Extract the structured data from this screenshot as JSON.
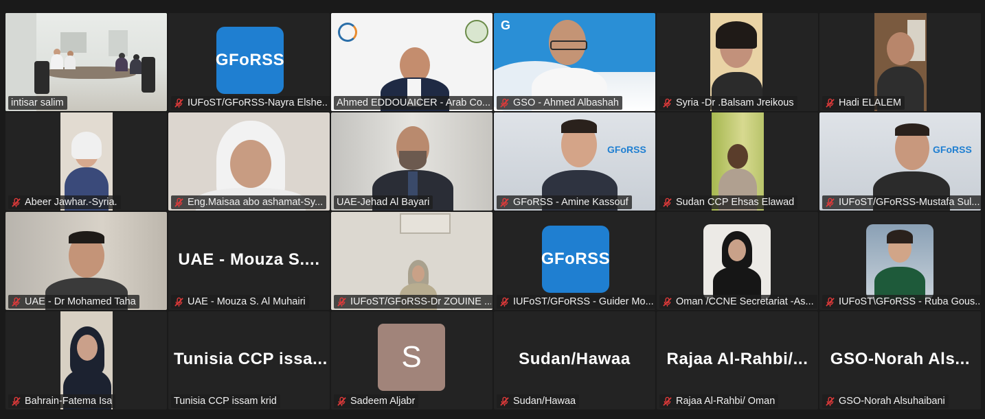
{
  "colors": {
    "active_border": "#23d962",
    "label_bg": "rgba(30,30,30,0.78)",
    "muted_icon": "#e03a3a",
    "avatar_bg": "#a1847a",
    "gforss_blue": "#1f7fd1"
  },
  "gforss_logo_text": "GFoRSS",
  "tiles": [
    {
      "label": "intisar salim",
      "muted": false,
      "active": true
    },
    {
      "label": "IUFoST/GFoRSS-Nayra Elshe...",
      "muted": true
    },
    {
      "label": "Ahmed EDDOUAICER - Arab Co...",
      "muted": false
    },
    {
      "label": "GSO - Ahmed Albashah",
      "muted": true
    },
    {
      "label": "Syria -Dr .Balsam Jreikous",
      "muted": true
    },
    {
      "label": "Hadi ELALEM",
      "muted": true
    },
    {
      "label": "Abeer Jawhar.-Syria.",
      "muted": true
    },
    {
      "label": "Eng.Maisaa abo ashamat-Sy...",
      "muted": true
    },
    {
      "label": "UAE-Jehad Al Bayari",
      "muted": false
    },
    {
      "label": "GFoRSS - Amine Kassouf",
      "muted": true
    },
    {
      "label": "Sudan CCP Ehsas Elawad",
      "muted": true
    },
    {
      "label": "IUFoST/GFoRSS-Mustafa Sul...",
      "muted": true
    },
    {
      "label": "UAE - Dr Mohamed Taha",
      "muted": true
    },
    {
      "label": "UAE - Mouza S. Al Muhairi",
      "muted": true,
      "display_name": "UAE - Mouza S...."
    },
    {
      "label": "IUFoST/GFoRSS-Dr ZOUINE ...",
      "muted": true
    },
    {
      "label": "IUFoST/GFoRSS - Guider Mo...",
      "muted": true
    },
    {
      "label": "Oman /CCNE Secretariat -As...",
      "muted": true
    },
    {
      "label": "IUFoST\\GFoRSS - Ruba Gous...",
      "muted": true
    },
    {
      "label": "Bahrain-Fatema Isa",
      "muted": true
    },
    {
      "label": "Tunisia CCP issam krid",
      "muted": false,
      "display_name": "Tunisia CCP issa..."
    },
    {
      "label": "Sadeem Aljabr",
      "muted": true,
      "avatar_letter": "S"
    },
    {
      "label": "Sudan/Hawaa",
      "muted": true,
      "display_name": "Sudan/Hawaa"
    },
    {
      "label": "Rajaa Al-Rahbi/ Oman",
      "muted": true,
      "display_name": "Rajaa Al-Rahbi/..."
    },
    {
      "label": "GSO-Norah Alsuhaibani",
      "muted": true,
      "display_name": "GSO-Norah Als..."
    }
  ]
}
